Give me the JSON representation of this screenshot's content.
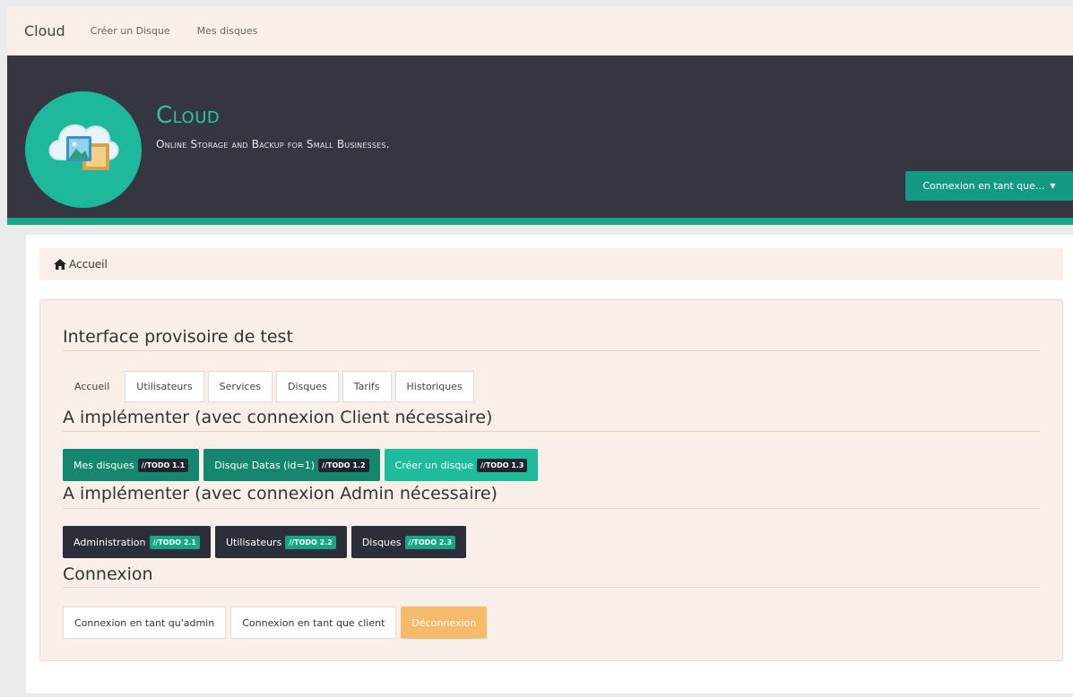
{
  "nav": {
    "brand": "Cloud",
    "links": [
      "Créer un Disque",
      "Mes disques"
    ]
  },
  "header": {
    "title": "Cloud",
    "subtitle": "Online Storage and Backup for Small Businesses.",
    "login_dropdown": "Connexion en tant que...",
    "colors": {
      "banner": "#363640",
      "accent": "#17a589",
      "logo": "#1eb89b"
    }
  },
  "breadcrumb": {
    "icon": "home-icon",
    "label": "Accueil"
  },
  "main": {
    "heading": "Interface provisoire de test",
    "tabs": [
      "Accueil",
      "Utilisateurs",
      "Services",
      "Disques",
      "Tarifs",
      "Historiques"
    ],
    "active_tab": "Accueil",
    "client_section": {
      "heading": "A implémenter (avec connexion Client nécessaire)",
      "buttons": [
        {
          "label": "Mes disques",
          "todo": "//TODO 1.1"
        },
        {
          "label": "Disque Datas (id=1)",
          "todo": "//TODO 1.2"
        },
        {
          "label": "Créer un disque",
          "todo": "//TODO 1.3"
        }
      ]
    },
    "admin_section": {
      "heading": "A implémenter (avec connexion Admin nécessaire)",
      "buttons": [
        {
          "label": "Administration",
          "todo": "//TODO 2.1"
        },
        {
          "label": "Utilisateurs",
          "todo": "//TODO 2.2"
        },
        {
          "label": "Disques",
          "todo": "//TODO 2.3"
        }
      ]
    },
    "connexion_section": {
      "heading": "Connexion",
      "buttons": [
        "Connexion en tant qu'admin",
        "Connexion en tant que client",
        "Déconnexion"
      ]
    }
  }
}
